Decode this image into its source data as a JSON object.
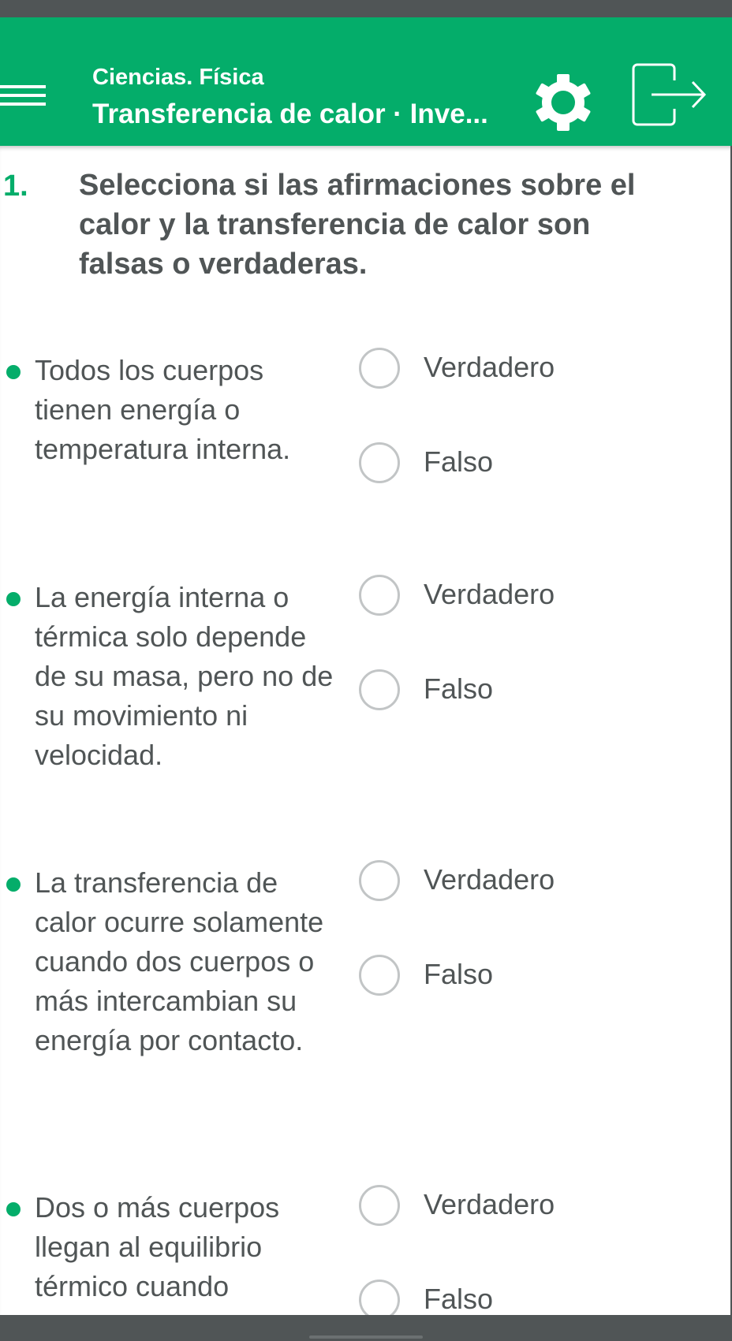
{
  "header": {
    "course": "Ciencias. Física",
    "lesson": "Transferencia de calor · Inve...",
    "icons": [
      "menu-icon",
      "gear-icon",
      "logout-icon"
    ],
    "background_color": "#04ad6a"
  },
  "question": {
    "number": "1.",
    "text": "Selecciona si las afirmaciones sobre el calor y la transferencia de calor son falsas o verdaderas."
  },
  "statements": [
    {
      "text": "Todos los cuerpos tienen energía o temperatura interna.",
      "option_true": "Verdadero",
      "option_false": "Falso"
    },
    {
      "text": "La energía interna o térmica solo depende de su masa, pero no de su movimiento ni velocidad.",
      "option_true": "Verdadero",
      "option_false": "Falso"
    },
    {
      "text": "La transferencia de calor ocurre solamente cuando dos cuerpos o más intercambian su energía por contacto.",
      "option_true": "Verdadero",
      "option_false": "Falso"
    },
    {
      "text": "Dos o más cuerpos llegan al equilibrio térmico cuando",
      "option_true": "Verdadero",
      "option_false": "Falso"
    }
  ],
  "colors": {
    "accent": "#04ad6a",
    "text": "#505556",
    "radio_border": "#c2c5c6"
  }
}
